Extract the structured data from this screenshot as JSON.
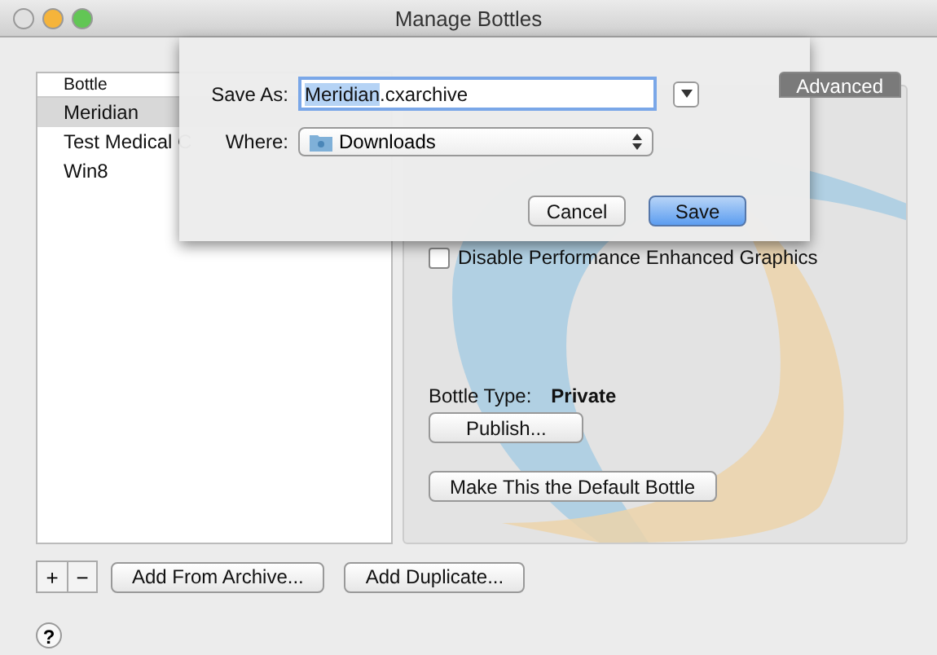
{
  "window": {
    "title": "Manage Bottles"
  },
  "bottle_list": {
    "column": "Bottle",
    "items": [
      {
        "name": "Meridian",
        "selected": true
      },
      {
        "name": "Test Medical C",
        "selected": false
      },
      {
        "name": "Win8",
        "selected": false
      }
    ]
  },
  "tabs": [
    {
      "label": "Advanced",
      "selected": true
    }
  ],
  "options": [
    {
      "label": "Disable Performance Enhanced Graphics",
      "checked": false
    }
  ],
  "bottle_type": {
    "label": "Bottle Type:",
    "value": "Private"
  },
  "panel_buttons": [
    "Publish...",
    "Make This the Default Bottle"
  ],
  "list_controls": [
    "+",
    "−"
  ],
  "bottom_buttons": [
    "Add From Archive...",
    "Add Duplicate..."
  ],
  "help": "?",
  "save_sheet": {
    "save_as_label": "Save As:",
    "name_selected": "Meridian",
    "name_rest": ".cxarchive",
    "where_label": "Where:",
    "location": "Downloads",
    "buttons": [
      {
        "label": "Cancel",
        "default": false
      },
      {
        "label": "Save",
        "default": true
      }
    ]
  }
}
